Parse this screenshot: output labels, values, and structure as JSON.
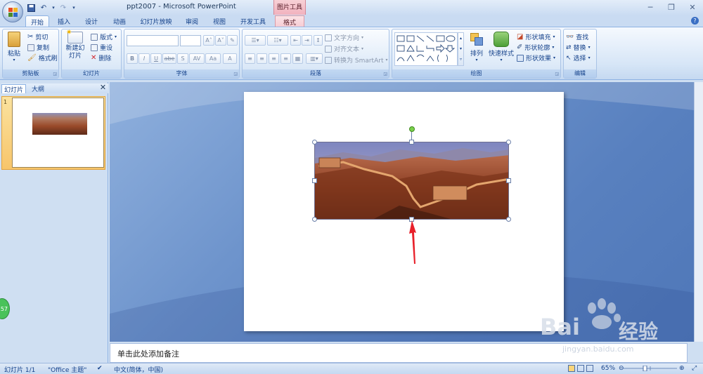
{
  "window": {
    "title": "ppt2007 - Microsoft PowerPoint",
    "context_tab_group": "图片工具"
  },
  "ribbon_tabs": [
    "开始",
    "插入",
    "设计",
    "动画",
    "幻灯片放映",
    "审阅",
    "视图",
    "开发工具",
    "格式"
  ],
  "groups": {
    "clipboard": {
      "caption": "剪贴板",
      "paste": "粘贴",
      "cut": "剪切",
      "copy": "复制",
      "format_painter": "格式刷"
    },
    "slides": {
      "caption": "幻灯片",
      "new_slide": "新建幻灯片",
      "layout": "版式",
      "reset": "重设",
      "delete": "删除"
    },
    "font": {
      "caption": "字体",
      "buttons": [
        "B",
        "I",
        "U",
        "abe",
        "S",
        "AV",
        "Aa",
        "A"
      ]
    },
    "paragraph": {
      "caption": "段落",
      "text_direction": "文字方向",
      "align_text": "对齐文本",
      "convert_smartart": "转换为 SmartArt"
    },
    "drawing": {
      "caption": "绘图",
      "arrange": "排列",
      "quick_styles": "快速样式",
      "shape_fill": "形状填充",
      "shape_outline": "形状轮廓",
      "shape_effects": "形状效果"
    },
    "editing": {
      "caption": "编辑",
      "find": "查找",
      "replace": "替换",
      "select": "选择"
    }
  },
  "pane": {
    "tabs": [
      "幻灯片",
      "大纲"
    ],
    "slide_number": "1"
  },
  "notes_placeholder": "单击此处添加备注",
  "status": {
    "slide_info": "幻灯片 1/1",
    "theme": "\"Office 主题\"",
    "language": "中文(简体，中国)",
    "zoom": "65%"
  },
  "watermark": {
    "brand": "Bai",
    "brand_cn": "经验",
    "url": "jingyan.baidu.com"
  },
  "badge": "57",
  "colors": {
    "accent_blue": "#15428b",
    "context_pink": "#f1b0bd",
    "arrow_red": "#e8202a"
  }
}
